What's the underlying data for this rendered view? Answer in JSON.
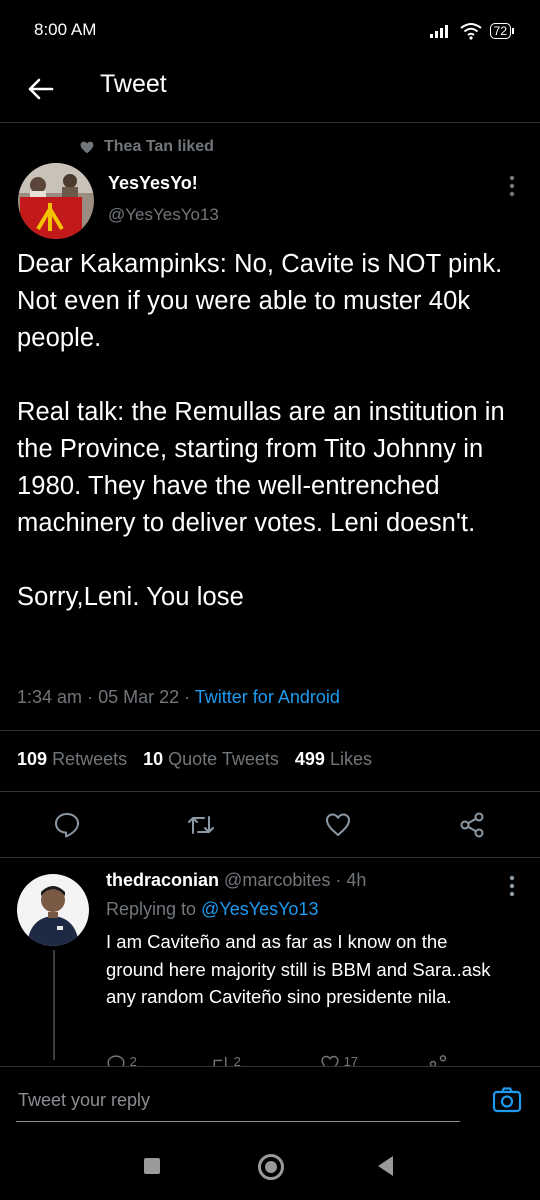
{
  "status": {
    "time": "8:00 AM",
    "battery": "72"
  },
  "header": {
    "title": "Tweet"
  },
  "tweet": {
    "social_context": "Thea Tan liked",
    "author_name": "YesYesYo!",
    "author_handle": "@YesYesYo13",
    "text": "Dear Kakampinks: No, Cavite is NOT pink. Not even if you were able to muster 40k people.\n\nReal talk: the Remullas are an institution in the Province, starting from Tito Johnny in 1980. They have the well-entrenched machinery to deliver votes. Leni doesn't.\n\nSorry,Leni. You lose",
    "time": "1:34 am",
    "date": "05 Mar 22",
    "source": "Twitter for Android",
    "stats": {
      "retweets_count": "109",
      "retweets_label": "Retweets",
      "quotes_count": "10",
      "quotes_label": "Quote Tweets",
      "likes_count": "499",
      "likes_label": "Likes"
    }
  },
  "reply": {
    "author_name": "thedraconian",
    "author_handle": "@marcobites",
    "age": "4h",
    "replying_to_label": "Replying to",
    "replying_to_handle": "@YesYesYo13",
    "text": "I am Caviteño and as far as I know on the ground here majority still is BBM and Sara..ask any random Caviteño sino presidente nila.",
    "reply_count": "2",
    "retweet_count": "2",
    "like_count": "17"
  },
  "compose": {
    "placeholder": "Tweet your reply"
  },
  "colors": {
    "link": "#1d9bf0",
    "muted": "#71767b",
    "divider": "#2f3336",
    "background": "#000000"
  }
}
